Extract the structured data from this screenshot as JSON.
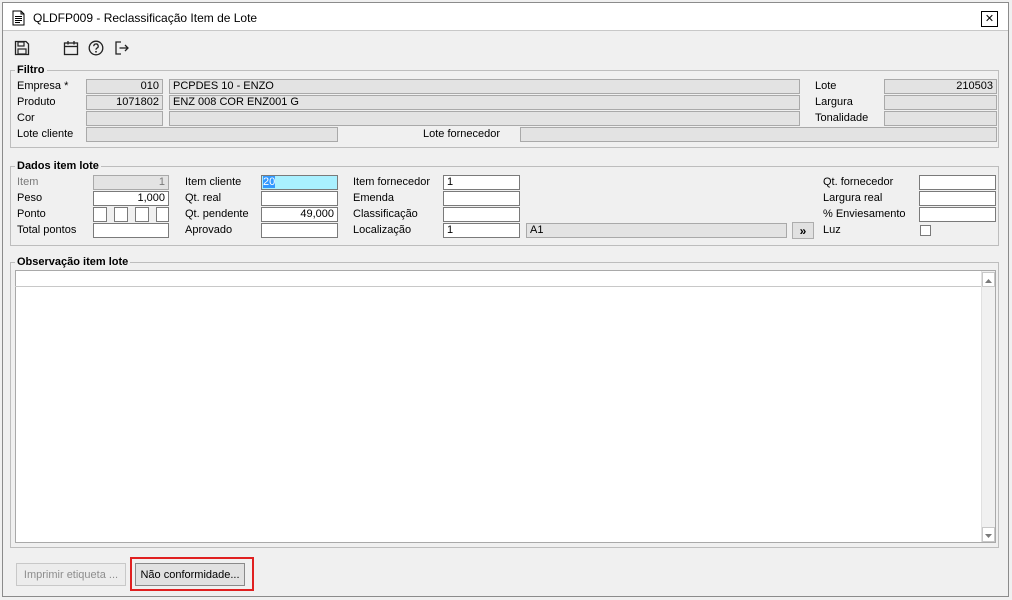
{
  "window": {
    "title": "QLDFP009 - Reclassificação Item de Lote",
    "close_symbol": "✕"
  },
  "toolbar": [
    {
      "icon": "save-icon"
    },
    {
      "icon": "calendar-icon"
    },
    {
      "icon": "help-icon"
    },
    {
      "icon": "exit-icon"
    }
  ],
  "filtro": {
    "title": "Filtro",
    "empresa_label": "Empresa *",
    "empresa_code": "010",
    "empresa_name": "PCPDES 10 - ENZO",
    "produto_label": "Produto",
    "produto_code": "1071802",
    "produto_name": "ENZ 008 COR ENZ001 G",
    "cor_label": "Cor",
    "cor_code": "",
    "cor_name": "",
    "lote_cliente_label": "Lote cliente",
    "lote_cliente_value": "",
    "lote_fornecedor_label": "Lote fornecedor",
    "lote_fornecedor_value": "",
    "lote_label": "Lote",
    "lote_value": "210503",
    "largura_label": "Largura",
    "largura_value": "",
    "tonalidade_label": "Tonalidade",
    "tonalidade_value": ""
  },
  "dados": {
    "title": "Dados item lote",
    "item_label": "Item",
    "item_value": "1",
    "peso_label": "Peso",
    "peso_value": "1,000",
    "ponto_label": "Ponto",
    "total_pontos_label": "Total pontos",
    "total_pontos_value": "",
    "item_cliente_label": "Item cliente",
    "item_cliente_value": "20",
    "qt_real_label": "Qt. real",
    "qt_real_value": "",
    "qt_pendente_label": "Qt. pendente",
    "qt_pendente_value": "49,000",
    "aprovado_label": "Aprovado",
    "aprovado_value": "",
    "item_fornecedor_label": "Item fornecedor",
    "item_fornecedor_value": "1",
    "emenda_label": "Emenda",
    "emenda_value": "",
    "classificacao_label": "Classificação",
    "classificacao_value": "",
    "localizacao_label": "Localização",
    "localizacao_value": "1",
    "localizacao_desc": "A1",
    "localizacao_button": "»",
    "qt_fornecedor_label": "Qt. fornecedor",
    "qt_fornecedor_value": "",
    "largura_real_label": "Largura real",
    "largura_real_value": "",
    "enviesamento_label": "% Enviesamento",
    "enviesamento_value": "",
    "luz_label": "Luz",
    "luz_checked": false
  },
  "observacao": {
    "title": "Observação item lote",
    "value": ""
  },
  "buttons": {
    "imprimir_label": "Imprimir etiqueta ...",
    "nao_conformidade_label": "Não conformidade..."
  },
  "colors": {
    "highlight_border": "#e02020",
    "selected_field_bg": "#a9f0ff",
    "selection": "#3399ff"
  }
}
